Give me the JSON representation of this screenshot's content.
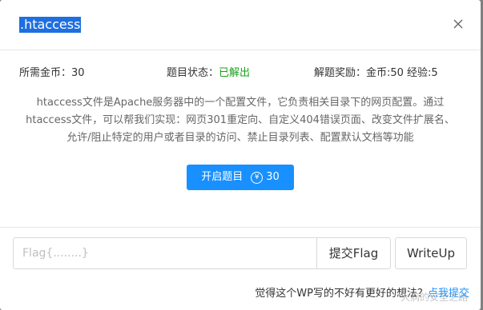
{
  "modal": {
    "title": ".htaccess",
    "close_icon": "close-icon"
  },
  "info": {
    "coins_required": "所需金币：30",
    "status_label": "题目状态：",
    "status_value": "已解出",
    "reward": "解题奖励：金币:50 经验:5"
  },
  "description": "htaccess文件是Apache服务器中的一个配置文件，它负责相关目录下的网页配置。通过htaccess文件，可以帮我们实现：网页301重定向、自定义404错误页面、改变文件扩展名、允许/阻止特定的用户或者目录的访问、禁止目录列表、配置默认文档等功能",
  "start_button": {
    "label": "开启题目",
    "coin_icon": "yen-coin-icon",
    "coin_symbol": "¥",
    "cost": "30"
  },
  "flag": {
    "placeholder": "Flag{........}",
    "value": ""
  },
  "submit_label": "提交Flag",
  "writeup_label": "WriteUp",
  "feedback": {
    "text": "觉得这个WP写的不好有更好的想法？",
    "link": "点我提交"
  },
  "watermark": "大病的安全之路",
  "colors": {
    "primary": "#1890ff",
    "solved": "#18a018",
    "title_highlight": "#1e6fe0"
  }
}
